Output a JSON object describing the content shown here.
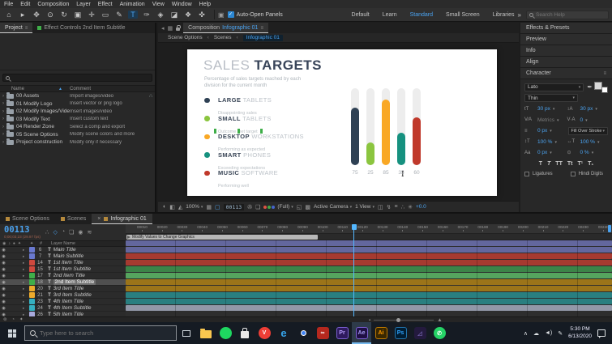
{
  "icons": {
    "eye": "◉",
    "chevron": "▸",
    "type_badge": "T",
    "tree_chevron": "›",
    "sort_asc": "▲",
    "panel_menu": "≡",
    "back": "◂",
    "grid": "▦",
    "audio": "♪",
    "solo": "●",
    "lock_flag": "✦",
    "hash": "#",
    "overflow": "»",
    "font_size": "tT",
    "leading": "↕A",
    "kerning": "V∕A",
    "tracking": "V·A",
    "stroke_width": "≡",
    "vertical_scale": "↕T",
    "horizontal_scale": "↔T",
    "baseline": "Aa",
    "tsume": "⊙",
    "eyedropper": "✒"
  },
  "menu": {
    "items": [
      "File",
      "Edit",
      "Composition",
      "Layer",
      "Effect",
      "Animation",
      "View",
      "Window",
      "Help"
    ]
  },
  "toolbar": {
    "tools": [
      {
        "name": "home-tool",
        "glyph": "⌂"
      },
      {
        "name": "selection-tool",
        "glyph": "▸"
      },
      {
        "name": "hand-tool",
        "glyph": "✥"
      },
      {
        "name": "zoom-tool",
        "glyph": "⊙"
      },
      {
        "name": "rotate-tool",
        "glyph": "↻"
      },
      {
        "name": "camera-tool",
        "glyph": "▣"
      },
      {
        "name": "pan-behind-tool",
        "glyph": "✛"
      },
      {
        "name": "shape-tool",
        "glyph": "▭"
      },
      {
        "name": "pen-tool",
        "glyph": "✎"
      },
      {
        "name": "type-tool",
        "glyph": "T",
        "active": true
      },
      {
        "name": "brush-tool",
        "glyph": "✑"
      },
      {
        "name": "clone-stamp-tool",
        "glyph": "◈"
      },
      {
        "name": "eraser-tool",
        "glyph": "◪"
      },
      {
        "name": "roto-brush-tool",
        "glyph": "❖"
      },
      {
        "name": "puppet-pin-tool",
        "glyph": "✜"
      }
    ],
    "auto_open_label": "Auto-Open Panels",
    "workspaces": [
      {
        "label": "Default"
      },
      {
        "label": "Learn"
      },
      {
        "label": "Standard",
        "active": true
      },
      {
        "label": "Small Screen"
      },
      {
        "label": "Libraries"
      }
    ],
    "help_search_placeholder": "Search Help"
  },
  "project": {
    "tab_label": "Project",
    "effect_controls_tab": "Effect Controls 2nd Item Subtitle",
    "columns": {
      "name": "Name",
      "comment": "Comment"
    },
    "rows": [
      {
        "name": "00 Assets",
        "comment": "Import images/video"
      },
      {
        "name": "01 Modify Logo",
        "comment": "Insert vector or png logo"
      },
      {
        "name": "02 Modify Images/Video",
        "comment": "Insert images/video"
      },
      {
        "name": "03 Modify Text",
        "comment": "Insert custom text"
      },
      {
        "name": "04 Render Zone",
        "comment": "Select a comp and export"
      },
      {
        "name": "05 Scene Options",
        "comment": "Modify scene colors and more"
      },
      {
        "name": "Project construction",
        "comment": "Modify only if necessary"
      }
    ]
  },
  "comp": {
    "tab_prefix": "Composition",
    "tab_name": "Infographic 01",
    "breadcrumb": [
      "Scene Options",
      "Scenes",
      "Infographic 01"
    ],
    "viewer_items": [
      {
        "name": "always-preview-icon",
        "g": "◐"
      },
      {
        "name": "main-view-icon",
        "g": "◧"
      },
      {
        "name": "view-options-icon",
        "g": "◭"
      },
      {
        "name": "magnification-select",
        "v": "100%",
        "dd": true
      },
      {
        "name": "grid-guides-icon",
        "g": "▦"
      },
      {
        "name": "mask-visibility-icon",
        "g": "▢",
        "blue": true
      },
      {
        "name": "current-frame",
        "v": "00113",
        "time": true
      },
      {
        "name": "snapshot-icon",
        "g": "✇"
      },
      {
        "name": "show-snapshot-icon",
        "g": "❏"
      },
      {
        "name": "channels-icon",
        "rgb": true
      },
      {
        "name": "resolution-select",
        "v": "(Full)",
        "dd": true
      },
      {
        "name": "roi-icon",
        "g": "◱"
      },
      {
        "name": "transparency-grid-icon",
        "g": "▩"
      },
      {
        "name": "camera-select",
        "v": "Active Camera",
        "dd": true
      },
      {
        "name": "view-layout-select",
        "v": "1 View",
        "dd": true
      },
      {
        "name": "pixel-aspect-icon",
        "g": "◫"
      },
      {
        "name": "fast-previews-icon",
        "g": "↯"
      },
      {
        "name": "timeline-button-icon",
        "g": "≡"
      },
      {
        "name": "flowchart-icon",
        "g": "∴"
      },
      {
        "name": "reset-exposure-icon",
        "g": "✳"
      },
      {
        "name": "exposure-value",
        "v": "+0.0",
        "blue": true
      }
    ]
  },
  "infographic": {
    "title_light": "SALES",
    "title_bold": "TARGETS",
    "subtitle_line1": "Percentage of sales targets reached by each",
    "subtitle_line2": "division for the current month",
    "legend": [
      {
        "bold": "LARGE",
        "light": "TABLETS",
        "sub": "Disappointing sales",
        "color": "#2f4154"
      },
      {
        "bold": "SMALL",
        "light": "TABLETS",
        "sub": "Outcome met target",
        "color": "#8bc53f",
        "editing": true
      },
      {
        "bold": "DESKTOP",
        "light": "WORKSTATIONS",
        "sub": "Performing as expected",
        "color": "#f9a825"
      },
      {
        "bold": "SMART",
        "light": "PHONES",
        "sub": "Exceeding expectations",
        "color": "#16917f"
      },
      {
        "bold": "MUSIC",
        "light": "SOFTWARE",
        "sub": "Performing well",
        "color": "#c0392b"
      }
    ],
    "bars": [
      {
        "value": "75",
        "pct": "75%",
        "color": "#2f4154"
      },
      {
        "value": "25",
        "pct": "30%",
        "color": "#8bc53f"
      },
      {
        "value": "85",
        "pct": "85%",
        "color": "#f9a825"
      },
      {
        "value": "35",
        "pct": "42%",
        "color": "#16917f"
      },
      {
        "value": "60",
        "pct": "62%",
        "color": "#c0392b"
      }
    ]
  },
  "chart_data": {
    "type": "bar",
    "title": "SALES TARGETS",
    "subtitle": "Percentage of sales targets reached by each division for the current month",
    "categories": [
      "LARGE TABLETS",
      "SMALL TABLETS",
      "DESKTOP WORKSTATIONS",
      "SMART PHONES",
      "MUSIC SOFTWARE"
    ],
    "values": [
      75,
      25,
      85,
      35,
      60
    ],
    "value_labels": [
      "75",
      "25",
      "85",
      "35",
      "60"
    ],
    "bar_colors": [
      "#2f4154",
      "#8bc53f",
      "#f9a825",
      "#16917f",
      "#c0392b"
    ],
    "annotations": [
      "Disappointing sales",
      "Outcome met target",
      "Performing as expected",
      "Exceeding expectations",
      "Performing well"
    ],
    "ylim": [
      0,
      100
    ],
    "grid": false,
    "legend_position": "left"
  },
  "right_panels": {
    "headers": [
      "Effects & Presets",
      "Preview",
      "Info",
      "Align"
    ],
    "character": {
      "title": "Character",
      "font_family": "Lato",
      "font_style": "Thin",
      "font_size": "30 px",
      "leading": "30 px",
      "kerning": "Metrics",
      "tracking": "0",
      "stroke_width": "0 px",
      "fill_mode": "Fill Over Stroke",
      "vertical_scale": "100 %",
      "horizontal_scale": "100 %",
      "baseline_shift": "0 px",
      "tsume": "0 %",
      "faux": [
        "T",
        "T",
        "TT",
        "Tt",
        "T¹",
        "T₁"
      ],
      "ligatures_label": "Ligatures",
      "hindi_label": "Hindi Digits"
    }
  },
  "timeline": {
    "tabs": [
      {
        "label": "Scene Options"
      },
      {
        "label": "Scenes"
      },
      {
        "label": "Infographic 01",
        "active": true
      }
    ],
    "timecode": "00113",
    "timecode_sub": "0;00;03;23 (29.97 fps)",
    "layer_name_header": "Layer Name",
    "marker_label": "Modify Values to Change Graphics",
    "panel_icons": [
      {
        "name": "comp-mini-flowchart-icon",
        "g": "∴"
      },
      {
        "name": "draft-3d-icon",
        "g": "◇",
        "blue": true
      },
      {
        "name": "hide-shy-icon",
        "g": "◔"
      },
      {
        "name": "frame-blend-icon",
        "g": "❏"
      },
      {
        "name": "motion-blur-icon",
        "g": "◉"
      },
      {
        "name": "graph-editor-icon",
        "g": "≋"
      }
    ],
    "bottom_icons": [
      {
        "name": "expand-switches-icon",
        "g": "⊚"
      },
      {
        "name": "expand-modes-icon",
        "g": "◔"
      },
      {
        "name": "expand-inout-icon",
        "g": "✦"
      }
    ],
    "ruler_ticks": [
      "00010",
      "00020",
      "00030",
      "00040",
      "00050",
      "00060",
      "00070",
      "00080",
      "00090",
      "00100",
      "00110",
      "00120",
      "00130",
      "00140",
      "00150",
      "00160",
      "00170",
      "00180",
      "00190",
      "00200",
      "00210",
      "00220",
      "00230",
      "00240"
    ],
    "layers": [
      {
        "num": "6",
        "name": "Main Title",
        "chip": "#6a79cf",
        "track": "#63679e"
      },
      {
        "num": "7",
        "name": "Main Subtitle",
        "chip": "#6a79cf",
        "track": "#63679e"
      },
      {
        "num": "14",
        "name": "1st Item Title",
        "chip": "#d1493e",
        "track": "#a63a30"
      },
      {
        "num": "15",
        "name": "1st Item Subtitle",
        "chip": "#d1493e",
        "track": "#a63a30"
      },
      {
        "num": "17",
        "name": "2nd Item Title",
        "chip": "#3fae49",
        "track": "#3c8448"
      },
      {
        "num": "18",
        "name": "2nd Item Subtitle",
        "chip": "#3fae49",
        "track": "#55a45e",
        "selected": true
      },
      {
        "num": "20",
        "name": "3rd Item Title",
        "chip": "#edab2c",
        "track": "#9b7419"
      },
      {
        "num": "21",
        "name": "3rd Item Subtitle",
        "chip": "#edab2c",
        "track": "#9b7419"
      },
      {
        "num": "23",
        "name": "4th Item Title",
        "chip": "#35b0c0",
        "track": "#297f80"
      },
      {
        "num": "24",
        "name": "4th Item Subtitle",
        "chip": "#35b0c0",
        "track": "#297f80"
      },
      {
        "num": "26",
        "name": "5th Item Title",
        "chip": "#a9aadc",
        "track": "#9298a8"
      }
    ]
  },
  "taskbar": {
    "search_placeholder": "Type here to search",
    "apps": [
      {
        "name": "file-explorer",
        "label": "",
        "bg": "#f9c74f",
        "fg": "#f9c74f",
        "folder": true
      },
      {
        "name": "spotify",
        "label": "",
        "bg": "#1ed760",
        "fg": "#0a5",
        "circle": true
      },
      {
        "name": "store",
        "label": "",
        "bg": "#e9e9e9",
        "fg": "#e9e9e9",
        "bag": true
      },
      {
        "name": "vivaldi",
        "label": "V",
        "bg": "#ef3e36",
        "fg": "#ffffff",
        "circle": true
      },
      {
        "name": "edge",
        "label": "e",
        "bg": "transparent",
        "fg": "#36a3e8",
        "big": true
      },
      {
        "name": "chrome",
        "label": "",
        "bg": "transparent",
        "fg": "#fff",
        "chrome": true
      },
      {
        "name": "creative-cloud",
        "label": "∞",
        "bg": "#b5281e",
        "fg": "#ffffff"
      },
      {
        "name": "premiere-pro",
        "label": "Pr",
        "bg": "#2f1a5e",
        "fg": "#b9a1ff",
        "bd": "#7a5fd0"
      },
      {
        "name": "after-effects",
        "label": "Ae",
        "bg": "#1f0f44",
        "fg": "#a49bf0",
        "bd": "#7a5fd0",
        "active": true
      },
      {
        "name": "illustrator",
        "label": "Ai",
        "bg": "#3a2800",
        "fg": "#ff9a00",
        "bd": "#c07a00"
      },
      {
        "name": "photoshop",
        "label": "Ps",
        "bg": "#001d33",
        "fg": "#2fa3ff",
        "bd": "#2273ad"
      },
      {
        "name": "unknown-app",
        "label": "◿",
        "bg": "#241a3e",
        "fg": "#6f5fa8"
      },
      {
        "name": "whatsapp",
        "label": "✆",
        "bg": "#25d366",
        "fg": "#ffffff",
        "circle": true
      }
    ],
    "tray_icons": [
      {
        "name": "hidden-icons-caret",
        "glyph": "∧"
      },
      {
        "name": "onedrive-icon",
        "glyph": "☁"
      },
      {
        "name": "volume-icon",
        "glyph": "◄)"
      },
      {
        "name": "pen-settings-icon",
        "glyph": "✎"
      }
    ],
    "time": "5:30 PM",
    "date": "6/13/2020"
  }
}
